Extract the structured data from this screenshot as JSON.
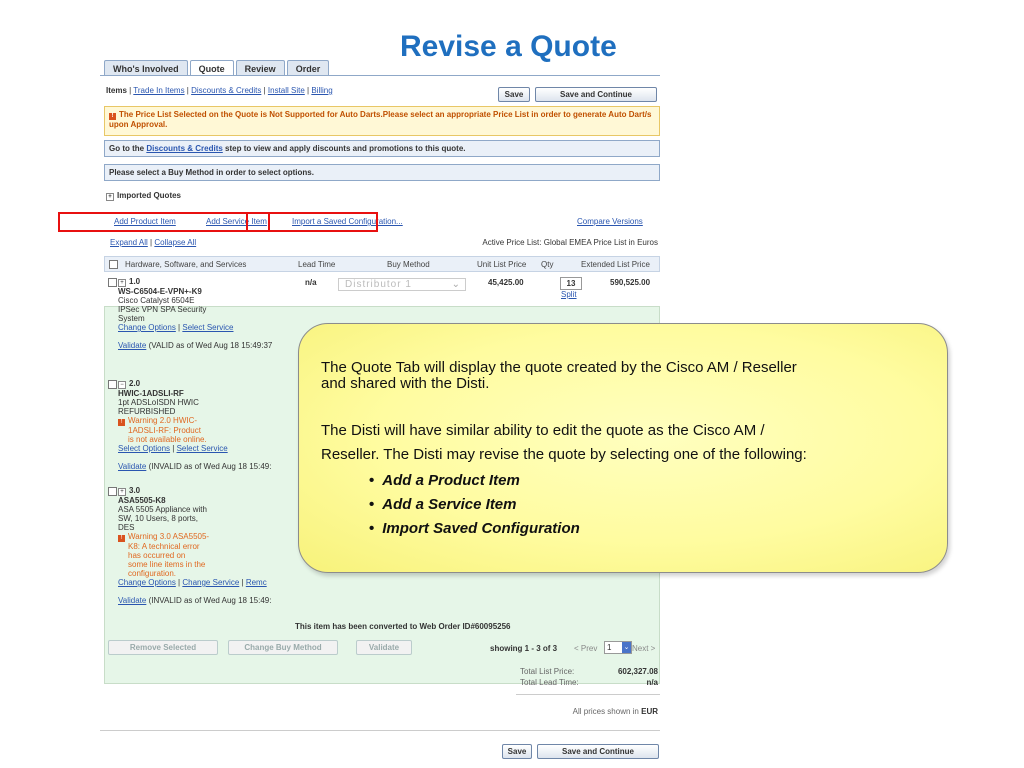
{
  "slide": {
    "title": "Revise a Quote"
  },
  "tabs": [
    "Who's Involved",
    "Quote",
    "Review",
    "Order"
  ],
  "subnav": {
    "current": "Items",
    "links": [
      "Trade In Items",
      "Discounts & Credits",
      "Install Site",
      "Billing"
    ]
  },
  "buttons": {
    "save": "Save",
    "save_continue": "Save and Continue",
    "remove_selected": "Remove Selected",
    "change_buy_method": "Change Buy Method",
    "validate": "Validate"
  },
  "messages": {
    "warning": "The Price List Selected on the Quote is Not Supported for Auto Darts.Please select an appropriate Price List in order to generate Auto Dart/s upon Approval.",
    "discount_pre": "Go to the",
    "discount_link": "Discounts & Credits",
    "discount_post": "step to view and apply discounts and promotions to this quote.",
    "buy_method": "Please select a Buy Method in order to select options.",
    "imported": "Imported Quotes"
  },
  "actions": {
    "add_product": "Add Product Item",
    "add_service": "Add Service Item",
    "import_config": "Import a Saved Configuration...",
    "compare": "Compare Versions",
    "expand_all": "Expand All",
    "collapse_all": "Collapse All"
  },
  "price_list": "Active Price List: Global EMEA Price List in Euros",
  "table": {
    "headers": [
      "Hardware, Software, and Services",
      "Lead Time",
      "Buy Method",
      "Unit List Price",
      "Qty",
      "Extended List Price"
    ],
    "row1": {
      "num": "1.0",
      "part": "WS-C6504-E-VPN+-K9",
      "desc": [
        "Cisco Catalyst 6504E",
        "IPSec VPN SPA Security",
        "System"
      ],
      "links": [
        "Change Options",
        "Select Service"
      ],
      "validate_link": "Validate",
      "validate_text": "(VALID as of Wed Aug 18 15:49:37",
      "lead_time": "n/a",
      "buy_method": "Distributor 1",
      "unit_price": "45,425.00",
      "qty": "13",
      "split": "Split",
      "ext_price": "590,525.00"
    },
    "row2": {
      "num": "2.0",
      "part": "HWIC-1ADSLI-RF",
      "desc": [
        "1pt ADSLoISDN HWIC",
        "REFURBISHED"
      ],
      "warning": [
        "Warning 2.0 HWIC-",
        "1ADSLI-RF: Product",
        "is not available online."
      ],
      "links": [
        "Select Options",
        "Select Service"
      ],
      "validate_link": "Validate",
      "validate_text": "(INVALID as of Wed Aug 18 15:49:"
    },
    "row3": {
      "num": "3.0",
      "part": "ASA5505-K8",
      "desc": [
        "ASA 5505 Appliance with",
        "SW, 10 Users, 8 ports,",
        "DES"
      ],
      "warning": [
        "Warning 3.0 ASA5505-",
        "K8: A technical error",
        "has occurred on",
        "some line items in the",
        "configuration."
      ],
      "links": [
        "Change Options",
        "Change Service",
        "Remc"
      ],
      "validate_link": "Validate",
      "validate_text": "(INVALID as of Wed Aug 18 15:49:"
    }
  },
  "converted": "This item has been converted to Web Order ID#60095256",
  "pagination": {
    "showing": "showing 1 - 3 of 3",
    "prev": "< Prev",
    "page": "1",
    "next": "Next >"
  },
  "totals": {
    "list_label": "Total List Price:",
    "list_value": "602,327.08",
    "lead_label": "Total Lead Time:",
    "lead_value": "n/a",
    "currency_note": "All prices shown in",
    "currency": "EUR"
  },
  "callout": {
    "line1": "The Quote Tab will display the quote created by the Cisco AM / Reseller",
    "line2": "and shared with the Disti.",
    "line3": "The Disti will have similar ability to edit the quote as the Cisco AM /",
    "line4": "Reseller. The Disti may revise the quote by selecting one of the following:",
    "bullets": [
      "Add a Product Item",
      "Add a Service Item",
      "Import Saved Configuration"
    ]
  }
}
